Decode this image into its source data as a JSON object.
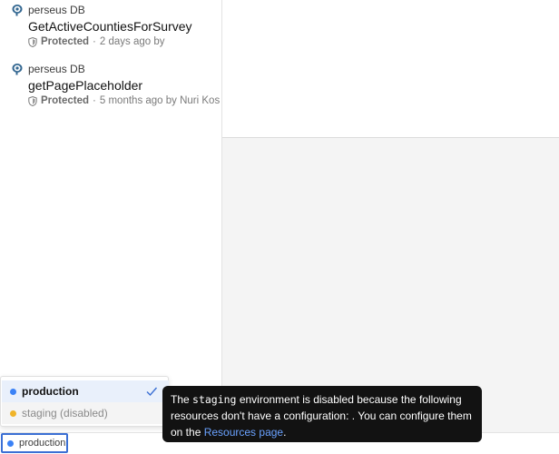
{
  "queries": [
    {
      "resource": "perseus DB",
      "name": "GetActiveCountiesForSurvey",
      "protected_label": "Protected",
      "meta": "2 days ago by"
    },
    {
      "resource": "perseus DB",
      "name": "getPagePlaceholder",
      "protected_label": "Protected",
      "meta": "5 months ago by Nuri Kos"
    }
  ],
  "environment": {
    "current": "production",
    "options": [
      {
        "label": "production",
        "selected": true,
        "color": "#3b82f6"
      },
      {
        "label": "staging (disabled)",
        "selected": false,
        "color": "#f0b429"
      }
    ]
  },
  "tooltip": {
    "part1": "The ",
    "code": "staging",
    "part2": " environment is disabled because the following resources don't have a configuration: . You can configure them on the ",
    "link": "Resources page",
    "part3": "."
  },
  "icons": {
    "db": "postgres-elephant-icon",
    "protected": "shield-icon",
    "check": "check-icon"
  },
  "colors": {
    "accent": "#3b6fd4",
    "tooltip_bg": "#121212",
    "link": "#6aa2ff"
  }
}
